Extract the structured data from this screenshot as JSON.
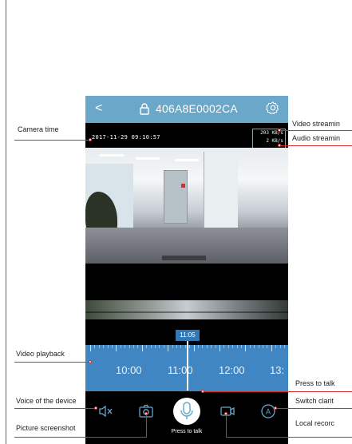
{
  "app": {
    "title": "406A8E0002CA",
    "back_label": "<",
    "settings_icon": "gear-icon",
    "lock_icon": "lock-icon"
  },
  "video": {
    "camera_time": "2017-11-29 09:10:57",
    "video_stream_rate": "203 KB/s",
    "audio_stream_rate": "2 KB/s"
  },
  "timeline": {
    "current_time": "11:05",
    "labels": [
      "10:00",
      "11:00",
      "12:00",
      "13:"
    ]
  },
  "controls": {
    "press_to_talk": "Press to talk",
    "mute_icon": "speaker-mute-icon",
    "screenshot_icon": "camera-icon",
    "mic_icon": "microphone-icon",
    "record_icon": "video-record-icon",
    "clarity_icon": "auto-clarity-icon"
  },
  "callouts": {
    "camera_time": "Camera time",
    "video_streaming": "Video streamin",
    "audio_streaming": "Audio streamin",
    "video_playback": "Video playback",
    "press_to_talk": "Press to talk",
    "voice_of_device": "Voice of the device",
    "switch_clarity": "Switch clarit",
    "picture_screenshot": "Picture screenshot",
    "local_record": "Local recorc"
  },
  "colors": {
    "accent": "#6aa7c9",
    "timeline": "#3f86c3",
    "callout": "#d42d2d"
  }
}
